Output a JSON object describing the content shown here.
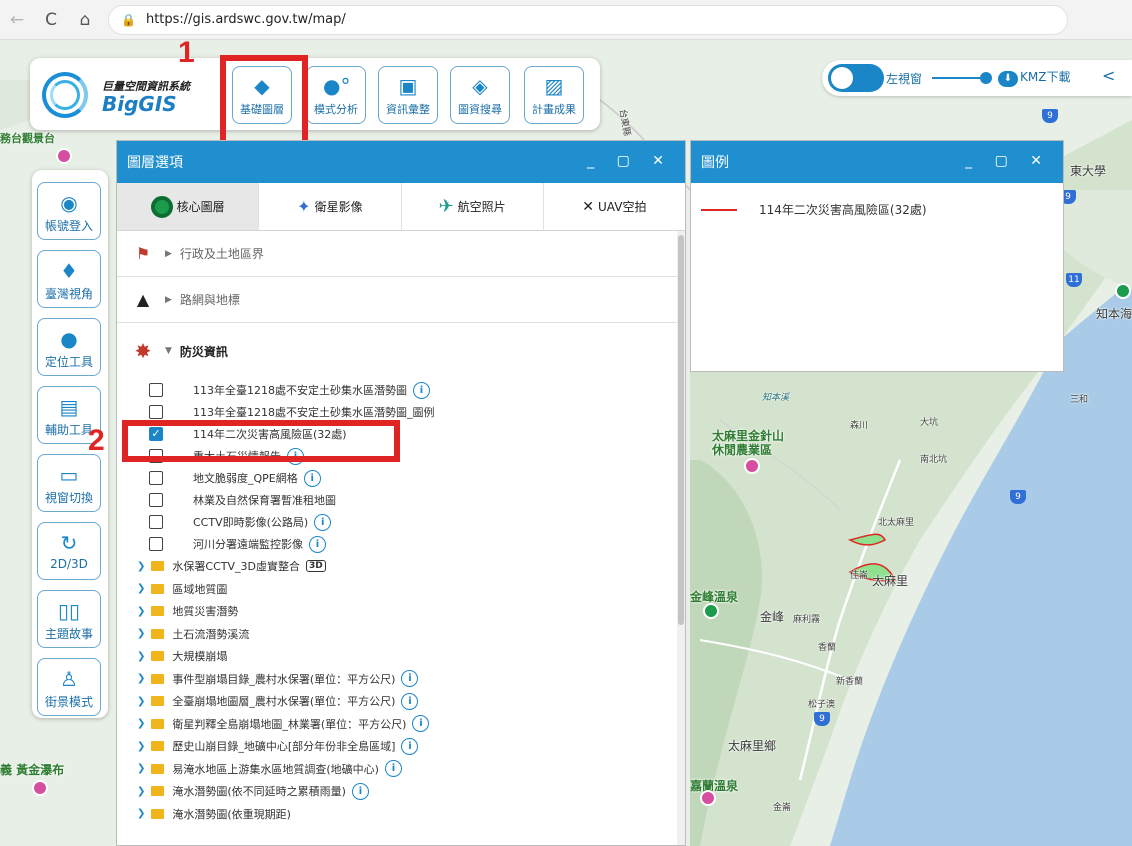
{
  "browser": {
    "url": "https://gis.ardswc.gov.tw/map/",
    "back_icon": "←",
    "reload_icon": "C",
    "home_icon": "⌂",
    "lock_icon": "🔒"
  },
  "logo": {
    "cn": "巨量空間資訊系統",
    "en": "BigGIS"
  },
  "toolbar": {
    "buttons": [
      {
        "label": "基礎圖層",
        "icon": "layers-icon"
      },
      {
        "label": "模式分析",
        "icon": "analysis-icon"
      },
      {
        "label": "資訊彙整",
        "icon": "info-summary-icon"
      },
      {
        "label": "圖資搜尋",
        "icon": "map-search-icon"
      },
      {
        "label": "計畫成果",
        "icon": "image-icon"
      }
    ]
  },
  "annotations": {
    "step1": "1",
    "step2": "2"
  },
  "right_controls": {
    "left_window_label": "左視窗",
    "kmz_label": "KMZ下載",
    "share_icon": "share-icon"
  },
  "sidebar": {
    "buttons": [
      {
        "label": "帳號登入",
        "icon": "user-icon"
      },
      {
        "label": "臺灣視角",
        "icon": "taiwan-icon"
      },
      {
        "label": "定位工具",
        "icon": "location-icon"
      },
      {
        "label": "輔助工具",
        "icon": "tools-icon"
      },
      {
        "label": "視窗切換",
        "icon": "window-icon"
      },
      {
        "label": "2D/3D",
        "icon": "3d-icon"
      },
      {
        "label": "主題故事",
        "icon": "book-icon"
      },
      {
        "label": "街景模式",
        "icon": "street-view-icon"
      }
    ]
  },
  "layer_panel": {
    "title": "圖層選項",
    "controls": "_ ▢ ✕",
    "tabs": [
      {
        "label": "核心圖層",
        "icon": "core-layer-icon",
        "active": true
      },
      {
        "label": "衛星影像",
        "icon": "satellite-icon",
        "active": false
      },
      {
        "label": "航空照片",
        "icon": "airplane-icon",
        "active": false
      },
      {
        "label": "UAV空拍",
        "icon": "drone-icon",
        "active": false
      }
    ],
    "groups": [
      {
        "label": "行政及土地區界",
        "icon": "flag-icon",
        "expanded": false
      },
      {
        "label": "路網與地標",
        "icon": "road-icon",
        "expanded": false
      },
      {
        "label": "防災資訊",
        "icon": "disaster-icon",
        "expanded": true
      }
    ],
    "layers": [
      {
        "label": "113年全臺1218處不安定土砂集水區潛勢圖",
        "checked": false,
        "info": true
      },
      {
        "label": "113年全臺1218處不安定土砂集水區潛勢圖_圖例",
        "checked": false,
        "info": false
      },
      {
        "label": "114年二次災害高風險區(32處)",
        "checked": true,
        "info": false
      },
      {
        "label": "重大土石災情報告",
        "checked": false,
        "info": true
      },
      {
        "label": "地文脆弱度_QPE網格",
        "checked": false,
        "info": true
      },
      {
        "label": "林業及自然保育署暫准租地圖",
        "checked": false,
        "info": false
      },
      {
        "label": "CCTV即時影像(公路局)",
        "checked": false,
        "info": true
      },
      {
        "label": "河川分署遠端監控影像",
        "checked": false,
        "info": true
      }
    ],
    "folders": [
      {
        "label": "水保署CCTV_3D虛實整合",
        "badge": "3D",
        "info": false
      },
      {
        "label": "區域地質圖",
        "badge": "",
        "info": false
      },
      {
        "label": "地質災害潛勢",
        "badge": "",
        "info": false
      },
      {
        "label": "土石流潛勢溪流",
        "badge": "",
        "info": false
      },
      {
        "label": "大規模崩塌",
        "badge": "",
        "info": false
      },
      {
        "label": "事件型崩塌目錄_農村水保署(單位：平方公尺)",
        "badge": "",
        "info": true
      },
      {
        "label": "全臺崩塌地圖層_農村水保署(單位：平方公尺)",
        "badge": "",
        "info": true
      },
      {
        "label": "衛星判釋全島崩塌地圖_林業署(單位：平方公尺)",
        "badge": "",
        "info": true
      },
      {
        "label": "歷史山崩目錄_地礦中心[部分年份非全島區域]",
        "badge": "",
        "info": true
      },
      {
        "label": "易淹水地區上游集水區地質調查(地礦中心)",
        "badge": "",
        "info": true
      },
      {
        "label": "淹水潛勢圖(依不同延時之累積雨量)",
        "badge": "",
        "info": true
      },
      {
        "label": "淹水潛勢圖(依重現期距)",
        "badge": "",
        "info": false
      }
    ]
  },
  "legend_panel": {
    "title": "圖例",
    "controls": "_ ▢ ✕",
    "items": [
      {
        "label": "114年二次災害高風險區(32處)",
        "color": "#e02424"
      }
    ]
  },
  "map": {
    "places": [
      {
        "text": "東大學"
      },
      {
        "text": "知本海"
      },
      {
        "text": "太麻里金針山"
      },
      {
        "text": "休閒農業區"
      },
      {
        "text": "太麻里"
      },
      {
        "text": "金峰溫泉"
      },
      {
        "text": "金峰"
      },
      {
        "text": "太麻里鄉"
      },
      {
        "text": "嘉蘭溫泉"
      },
      {
        "text": "義 黃金瀑布"
      },
      {
        "text": "務台觀景台"
      },
      {
        "text": "北太麻里"
      },
      {
        "text": "森川"
      },
      {
        "text": "大坑"
      },
      {
        "text": "南北坑"
      },
      {
        "text": "佳崙"
      },
      {
        "text": "松子澳"
      },
      {
        "text": "香蘭"
      },
      {
        "text": "新香蘭"
      },
      {
        "text": "金崙"
      },
      {
        "text": "知本溪"
      },
      {
        "text": "三和"
      },
      {
        "text": "麻利霧"
      },
      {
        "text": "台東縣"
      }
    ],
    "road_shields": [
      "9",
      "11",
      "9",
      "9",
      "9"
    ]
  }
}
